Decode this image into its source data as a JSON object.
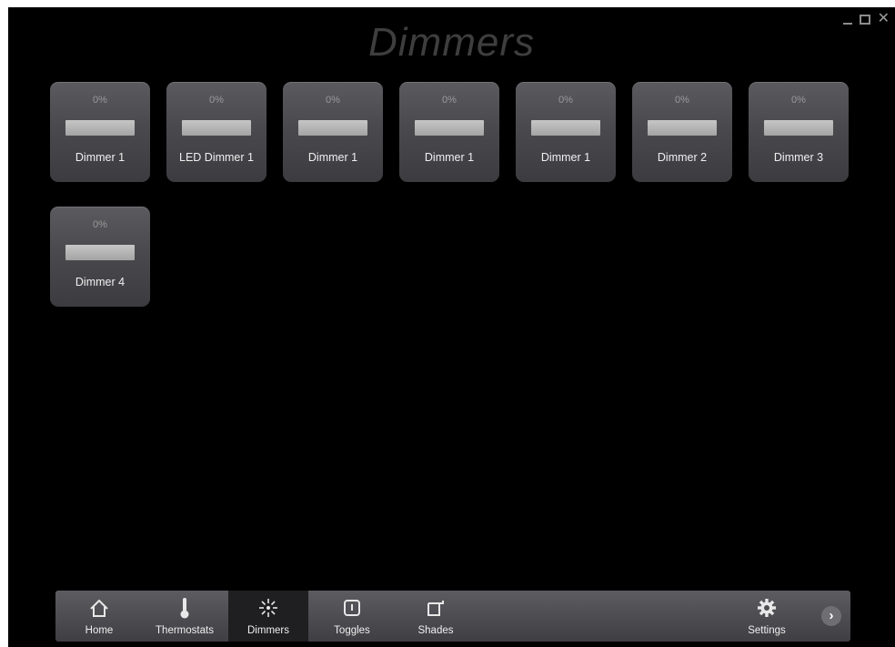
{
  "page": {
    "title": "Dimmers"
  },
  "window_controls": {
    "minimize": "minimize-icon",
    "maximize": "maximize-icon",
    "close": "close-icon"
  },
  "tiles": [
    {
      "level": "0%",
      "label": "Dimmer 1",
      "level_fraction": 0
    },
    {
      "level": "0%",
      "label": "LED Dimmer 1",
      "level_fraction": 0
    },
    {
      "level": "0%",
      "label": "Dimmer 1",
      "level_fraction": 0
    },
    {
      "level": "0%",
      "label": "Dimmer 1",
      "level_fraction": 0
    },
    {
      "level": "0%",
      "label": "Dimmer 1",
      "level_fraction": 0
    },
    {
      "level": "0%",
      "label": "Dimmer 2",
      "level_fraction": 0
    },
    {
      "level": "0%",
      "label": "Dimmer 3",
      "level_fraction": 0
    },
    {
      "level": "0%",
      "label": "Dimmer 4",
      "level_fraction": 0
    }
  ],
  "nav": {
    "items": [
      {
        "label": "Home",
        "icon": "home-icon"
      },
      {
        "label": "Thermostats",
        "icon": "thermometer-icon"
      },
      {
        "label": "Dimmers",
        "icon": "light-bulb-icon",
        "active": true
      },
      {
        "label": "Toggles",
        "icon": "toggle-icon"
      },
      {
        "label": "Shades",
        "icon": "shade-icon"
      },
      {
        "label": "Settings",
        "icon": "gear-icon"
      }
    ],
    "next": "chevron-right-icon",
    "next_label": "›"
  },
  "colors": {
    "background": "#000000",
    "tile": "#4a4a4e",
    "navbar": "#4d4d52",
    "active_nav": "#1f1f22",
    "title": "#3e3e3e"
  }
}
